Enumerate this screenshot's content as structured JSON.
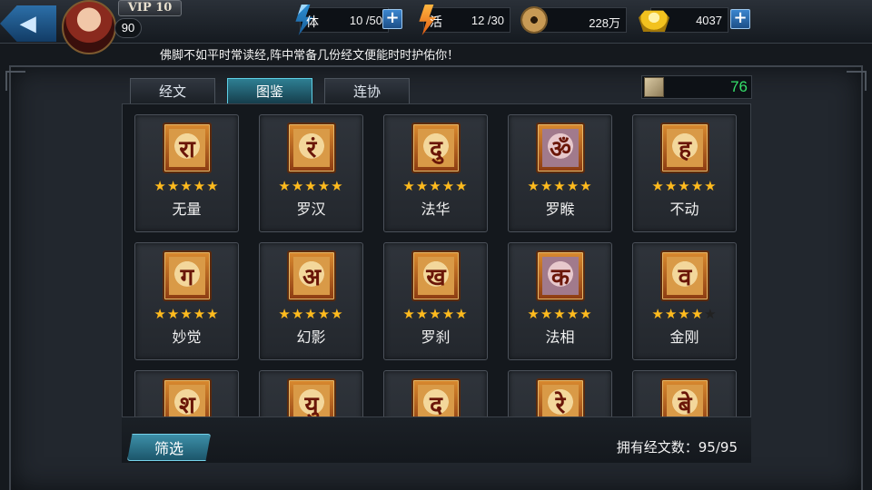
{
  "header": {
    "vip_label": "VIP 10",
    "level": "90",
    "stamina": {
      "label": "体",
      "value": "10 /50"
    },
    "energy": {
      "label": "活",
      "value": "12 /30"
    },
    "coins": {
      "value": "228万"
    },
    "gold": {
      "value": "4037"
    }
  },
  "ticker": "佛脚不如平时常读经,阵中常备几份经文便能时时护佑你！",
  "tabs": [
    {
      "label": "经文",
      "active": false
    },
    {
      "label": "图鉴",
      "active": true
    },
    {
      "label": "连协",
      "active": false
    }
  ],
  "sutra_count": "76",
  "cards": [
    {
      "name": "无量",
      "stars": 5,
      "max_stars": 5,
      "glyph": "रा"
    },
    {
      "name": "罗汉",
      "stars": 5,
      "max_stars": 5,
      "glyph": "रं"
    },
    {
      "name": "法华",
      "stars": 5,
      "max_stars": 5,
      "glyph": "दु"
    },
    {
      "name": "罗睺",
      "stars": 5,
      "max_stars": 5,
      "glyph": "ॐ"
    },
    {
      "name": "不动",
      "stars": 5,
      "max_stars": 5,
      "glyph": "ह"
    },
    {
      "name": "妙觉",
      "stars": 5,
      "max_stars": 5,
      "glyph": "ग"
    },
    {
      "name": "幻影",
      "stars": 5,
      "max_stars": 5,
      "glyph": "अ"
    },
    {
      "name": "罗刹",
      "stars": 5,
      "max_stars": 5,
      "glyph": "ख"
    },
    {
      "name": "法相",
      "stars": 5,
      "max_stars": 5,
      "glyph": "क"
    },
    {
      "name": "金刚",
      "stars": 4,
      "max_stars": 5,
      "glyph": "व"
    },
    {
      "name": "",
      "stars": 0,
      "max_stars": 0,
      "glyph": "श"
    },
    {
      "name": "",
      "stars": 0,
      "max_stars": 0,
      "glyph": "यु"
    },
    {
      "name": "",
      "stars": 0,
      "max_stars": 0,
      "glyph": "द"
    },
    {
      "name": "",
      "stars": 0,
      "max_stars": 0,
      "glyph": "रे"
    },
    {
      "name": "",
      "stars": 0,
      "max_stars": 0,
      "glyph": "बे"
    }
  ],
  "filter_button": "筛选",
  "owned_summary": "拥有经文数：95/95"
}
